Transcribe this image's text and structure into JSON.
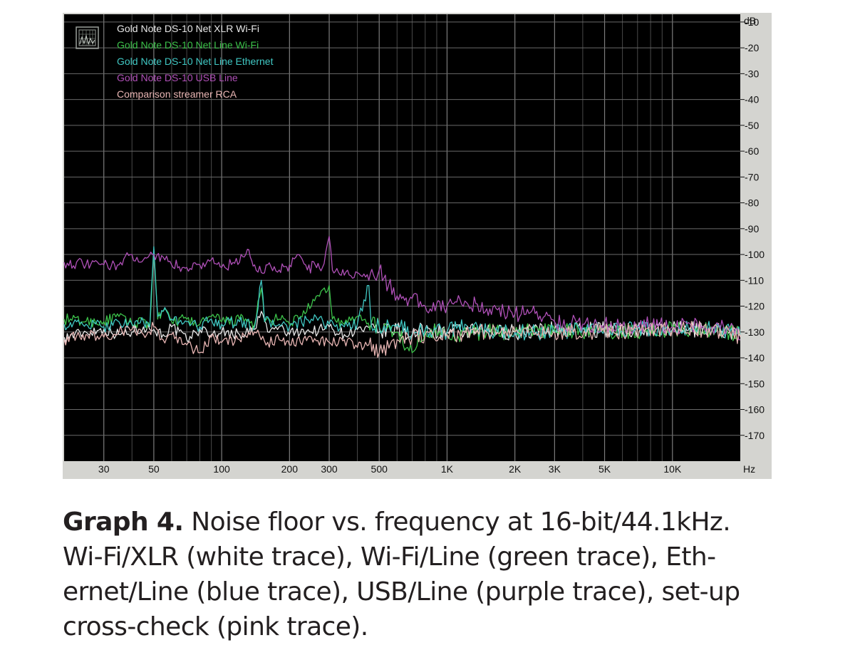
{
  "chart_data": {
    "type": "line",
    "title": "",
    "xlabel": "Hz",
    "ylabel": "dB",
    "x_scale": "log",
    "xlim": [
      20,
      20000
    ],
    "ylim": [
      -180,
      -7
    ],
    "grid": true,
    "legend_placement": "top-left",
    "x_ticks": [
      {
        "value": 30,
        "label": "30"
      },
      {
        "value": 50,
        "label": "50"
      },
      {
        "value": 100,
        "label": "100"
      },
      {
        "value": 200,
        "label": "200"
      },
      {
        "value": 300,
        "label": "300"
      },
      {
        "value": 500,
        "label": "500"
      },
      {
        "value": 1000,
        "label": "1K"
      },
      {
        "value": 2000,
        "label": "2K"
      },
      {
        "value": 3000,
        "label": "3K"
      },
      {
        "value": 5000,
        "label": "5K"
      },
      {
        "value": 10000,
        "label": "10K"
      }
    ],
    "y_ticks": [
      {
        "value": -10,
        "label": "-10"
      },
      {
        "value": -20,
        "label": "-20"
      },
      {
        "value": -30,
        "label": "-30"
      },
      {
        "value": -40,
        "label": "-40"
      },
      {
        "value": -50,
        "label": "-50"
      },
      {
        "value": -60,
        "label": "-60"
      },
      {
        "value": -70,
        "label": "-70"
      },
      {
        "value": -80,
        "label": "-80"
      },
      {
        "value": -90,
        "label": "-90"
      },
      {
        "value": -100,
        "label": "-100"
      },
      {
        "value": -110,
        "label": "-110"
      },
      {
        "value": -120,
        "label": "-120"
      },
      {
        "value": -130,
        "label": "-130"
      },
      {
        "value": -140,
        "label": "-140"
      },
      {
        "value": -150,
        "label": "-150"
      },
      {
        "value": -160,
        "label": "-160"
      },
      {
        "value": -170,
        "label": "-170"
      }
    ],
    "series": [
      {
        "name": "Gold Note DS-10 Net XLR Wi-Fi",
        "color": "#e8e8e8",
        "points": [
          [
            20,
            -132
          ],
          [
            25,
            -130
          ],
          [
            30,
            -129
          ],
          [
            35,
            -131
          ],
          [
            40,
            -130
          ],
          [
            45,
            -128
          ],
          [
            50,
            -129
          ],
          [
            55,
            -131
          ],
          [
            60,
            -128
          ],
          [
            70,
            -133
          ],
          [
            80,
            -129
          ],
          [
            90,
            -131
          ],
          [
            100,
            -130
          ],
          [
            120,
            -131
          ],
          [
            140,
            -129
          ],
          [
            150,
            -122
          ],
          [
            160,
            -130
          ],
          [
            180,
            -128
          ],
          [
            200,
            -131
          ],
          [
            230,
            -129
          ],
          [
            250,
            -130
          ],
          [
            300,
            -128
          ],
          [
            350,
            -131
          ],
          [
            400,
            -129
          ],
          [
            500,
            -130
          ],
          [
            600,
            -129
          ],
          [
            700,
            -131
          ],
          [
            800,
            -129
          ],
          [
            1000,
            -130
          ],
          [
            1500,
            -130
          ],
          [
            2000,
            -130
          ],
          [
            3000,
            -129
          ],
          [
            5000,
            -129
          ],
          [
            7000,
            -129
          ],
          [
            10000,
            -129
          ],
          [
            15000,
            -129
          ],
          [
            18000,
            -130
          ],
          [
            20000,
            -131
          ]
        ]
      },
      {
        "name": "Gold Note DS-10 Net Line Wi-Fi",
        "color": "#3cc24a",
        "points": [
          [
            20,
            -125
          ],
          [
            25,
            -126
          ],
          [
            30,
            -126
          ],
          [
            35,
            -124
          ],
          [
            40,
            -127
          ],
          [
            45,
            -125
          ],
          [
            48,
            -128
          ],
          [
            50,
            -98
          ],
          [
            52,
            -125
          ],
          [
            55,
            -122
          ],
          [
            60,
            -126
          ],
          [
            70,
            -125
          ],
          [
            80,
            -127
          ],
          [
            90,
            -124
          ],
          [
            100,
            -126
          ],
          [
            120,
            -125
          ],
          [
            140,
            -127
          ],
          [
            150,
            -113
          ],
          [
            155,
            -126
          ],
          [
            180,
            -125
          ],
          [
            200,
            -127
          ],
          [
            250,
            -120
          ],
          [
            300,
            -112
          ],
          [
            310,
            -125
          ],
          [
            350,
            -127
          ],
          [
            400,
            -124
          ],
          [
            500,
            -128
          ],
          [
            600,
            -130
          ],
          [
            700,
            -138
          ],
          [
            800,
            -129
          ],
          [
            1000,
            -131
          ],
          [
            1500,
            -130
          ],
          [
            2000,
            -130
          ],
          [
            3000,
            -129
          ],
          [
            5000,
            -130
          ],
          [
            10000,
            -129
          ],
          [
            15000,
            -129
          ],
          [
            18000,
            -130
          ],
          [
            20000,
            -131
          ]
        ]
      },
      {
        "name": "Gold Note DS-10 Net Line Ethernet",
        "color": "#40c8c4",
        "points": [
          [
            20,
            -127
          ],
          [
            25,
            -127
          ],
          [
            30,
            -128
          ],
          [
            35,
            -126
          ],
          [
            40,
            -127
          ],
          [
            45,
            -126
          ],
          [
            48,
            -128
          ],
          [
            50,
            -97
          ],
          [
            52,
            -124
          ],
          [
            55,
            -122
          ],
          [
            60,
            -125
          ],
          [
            70,
            -126
          ],
          [
            80,
            -128
          ],
          [
            90,
            -125
          ],
          [
            100,
            -127
          ],
          [
            120,
            -126
          ],
          [
            140,
            -128
          ],
          [
            150,
            -110
          ],
          [
            155,
            -126
          ],
          [
            180,
            -127
          ],
          [
            200,
            -128
          ],
          [
            250,
            -125
          ],
          [
            300,
            -127
          ],
          [
            350,
            -128
          ],
          [
            400,
            -127
          ],
          [
            450,
            -112
          ],
          [
            460,
            -127
          ],
          [
            500,
            -128
          ],
          [
            600,
            -127
          ],
          [
            700,
            -131
          ],
          [
            800,
            -129
          ],
          [
            1000,
            -130
          ],
          [
            1200,
            -127
          ],
          [
            1500,
            -130
          ],
          [
            2000,
            -130
          ],
          [
            2500,
            -130
          ],
          [
            3000,
            -130
          ],
          [
            5000,
            -129
          ],
          [
            10000,
            -129
          ],
          [
            15000,
            -129
          ],
          [
            18000,
            -130
          ],
          [
            20000,
            -131
          ]
        ]
      },
      {
        "name": "Gold Note DS-10 USB Line",
        "color": "#b050b8",
        "points": [
          [
            20,
            -103
          ],
          [
            25,
            -104
          ],
          [
            30,
            -104
          ],
          [
            35,
            -104
          ],
          [
            40,
            -100
          ],
          [
            45,
            -102
          ],
          [
            50,
            -100
          ],
          [
            55,
            -101
          ],
          [
            60,
            -104
          ],
          [
            70,
            -105
          ],
          [
            80,
            -104
          ],
          [
            90,
            -102
          ],
          [
            100,
            -105
          ],
          [
            120,
            -103
          ],
          [
            130,
            -98
          ],
          [
            140,
            -104
          ],
          [
            150,
            -107
          ],
          [
            160,
            -104
          ],
          [
            180,
            -106
          ],
          [
            200,
            -104
          ],
          [
            220,
            -100
          ],
          [
            240,
            -106
          ],
          [
            260,
            -104
          ],
          [
            280,
            -105
          ],
          [
            300,
            -93
          ],
          [
            310,
            -106
          ],
          [
            350,
            -108
          ],
          [
            400,
            -107
          ],
          [
            450,
            -110
          ],
          [
            500,
            -106
          ],
          [
            550,
            -112
          ],
          [
            600,
            -116
          ],
          [
            700,
            -117
          ],
          [
            800,
            -120
          ],
          [
            900,
            -119
          ],
          [
            1000,
            -120
          ],
          [
            1200,
            -118
          ],
          [
            1500,
            -121
          ],
          [
            2000,
            -123
          ],
          [
            2500,
            -122
          ],
          [
            3000,
            -126
          ],
          [
            4000,
            -127
          ],
          [
            5000,
            -127
          ],
          [
            6000,
            -128
          ],
          [
            7000,
            -128
          ],
          [
            8000,
            -127
          ],
          [
            10000,
            -128
          ],
          [
            12000,
            -127
          ],
          [
            15000,
            -128
          ],
          [
            18000,
            -128
          ],
          [
            20000,
            -133
          ]
        ]
      },
      {
        "name": "Comparison streamer RCA",
        "color": "#e9b6b4",
        "points": [
          [
            20,
            -133
          ],
          [
            25,
            -131
          ],
          [
            30,
            -132
          ],
          [
            35,
            -130
          ],
          [
            40,
            -129
          ],
          [
            45,
            -131
          ],
          [
            50,
            -128
          ],
          [
            55,
            -133
          ],
          [
            60,
            -131
          ],
          [
            70,
            -135
          ],
          [
            80,
            -138
          ],
          [
            90,
            -132
          ],
          [
            100,
            -134
          ],
          [
            120,
            -133
          ],
          [
            140,
            -130
          ],
          [
            160,
            -134
          ],
          [
            180,
            -133
          ],
          [
            200,
            -135
          ],
          [
            250,
            -132
          ],
          [
            300,
            -134
          ],
          [
            350,
            -133
          ],
          [
            400,
            -136
          ],
          [
            450,
            -135
          ],
          [
            500,
            -138
          ],
          [
            600,
            -133
          ],
          [
            700,
            -132
          ],
          [
            800,
            -131
          ],
          [
            1000,
            -131
          ],
          [
            1500,
            -130
          ],
          [
            2000,
            -130
          ],
          [
            3000,
            -130
          ],
          [
            5000,
            -130
          ],
          [
            10000,
            -129
          ],
          [
            15000,
            -129
          ],
          [
            18000,
            -130
          ],
          [
            20000,
            -132
          ]
        ]
      }
    ]
  },
  "icon": "spectrum-analyzer-icon",
  "caption": {
    "label": "Graph 4.",
    "lines": [
      " Noise floor vs. frequency at 16-bit/44.1kHz.",
      "Wi-Fi/XLR (white trace), Wi-Fi/Line (green trace), Eth-",
      "ernet/Line (blue trace), USB/Line (purple trace), set-up",
      "cross-check (pink trace)."
    ]
  }
}
